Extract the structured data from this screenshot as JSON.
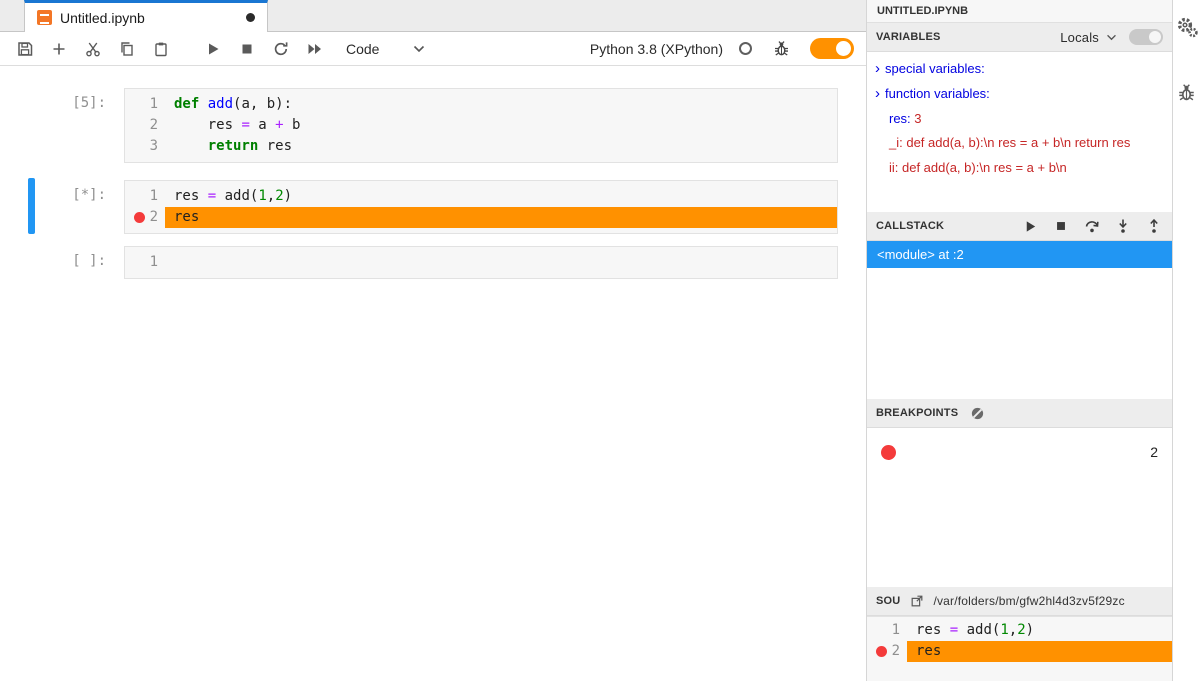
{
  "window": {
    "tab_title": "Untitled.ipynb"
  },
  "toolbar": {
    "cell_type": "Code",
    "kernel_name": "Python 3.8 (XPython)"
  },
  "notebook": {
    "cells": [
      {
        "prompt": "[5]:",
        "lines": [
          {
            "n": 1,
            "tokens": [
              [
                "def",
                "kw"
              ],
              [
                " ",
                "pl"
              ],
              [
                "add",
                "fn"
              ],
              [
                "(a, b):",
                "pl"
              ]
            ]
          },
          {
            "n": 2,
            "tokens": [
              [
                "    res ",
                "pl"
              ],
              [
                "=",
                "op"
              ],
              [
                " a ",
                "pl"
              ],
              [
                "+",
                "op"
              ],
              [
                " b",
                "pl"
              ]
            ]
          },
          {
            "n": 3,
            "tokens": [
              [
                "    ",
                "pl"
              ],
              [
                "return",
                "kw"
              ],
              [
                " res",
                "pl"
              ]
            ]
          }
        ]
      },
      {
        "prompt": "[*]:",
        "active": true,
        "lines": [
          {
            "n": 1,
            "tokens": [
              [
                "res ",
                "pl"
              ],
              [
                "=",
                "op"
              ],
              [
                " add(",
                "pl"
              ],
              [
                "1",
                "num"
              ],
              [
                ",",
                "pl"
              ],
              [
                "2",
                "num"
              ],
              [
                ")",
                "pl"
              ]
            ]
          },
          {
            "n": 2,
            "breakpoint": true,
            "highlight": true,
            "tokens": [
              [
                "res",
                "pl"
              ]
            ]
          }
        ]
      },
      {
        "prompt": "[ ]:",
        "lines": [
          {
            "n": 1,
            "tokens": []
          }
        ]
      }
    ]
  },
  "debugger": {
    "panel_title": "UNTITLED.IPYNB",
    "variables": {
      "header": "VARIABLES",
      "scope": "Locals",
      "items": [
        {
          "chevron": true,
          "segments": [
            [
              "special variables:",
              "blue"
            ]
          ]
        },
        {
          "chevron": true,
          "segments": [
            [
              "function variables:",
              "blue"
            ]
          ]
        },
        {
          "indent": true,
          "segments": [
            [
              "res: ",
              "blue"
            ],
            [
              "3",
              "red"
            ]
          ]
        },
        {
          "indent": true,
          "wrap": true,
          "segments": [
            [
              "_i: def add(a, b):\\n res = a + b\\n return res",
              "red"
            ]
          ]
        },
        {
          "indent": true,
          "segments": [
            [
              "ii: def add(a, b):\\n res = a + b\\n",
              "red"
            ]
          ]
        }
      ]
    },
    "callstack": {
      "header": "CALLSTACK",
      "frames": [
        {
          "label": "<module> at :2",
          "active": true
        }
      ]
    },
    "breakpoints": {
      "header": "BREAKPOINTS",
      "items": [
        {
          "line": "2"
        }
      ]
    },
    "source": {
      "header": "SOU",
      "path": "/var/folders/bm/gfw2hl4d3zv5f29zc",
      "lines": [
        {
          "n": 1,
          "tokens": [
            [
              "res ",
              "pl"
            ],
            [
              "=",
              "op"
            ],
            [
              " add(",
              "pl"
            ],
            [
              "1",
              "num"
            ],
            [
              ",",
              "pl"
            ],
            [
              "2",
              "num"
            ],
            [
              ")",
              "pl"
            ]
          ]
        },
        {
          "n": 2,
          "breakpoint": true,
          "highlight": true,
          "tokens": [
            [
              "res",
              "pl"
            ]
          ]
        }
      ]
    }
  },
  "colors": {
    "accent_blue": "#2196f3",
    "tab_border_blue": "#1976d2",
    "highlight_orange": "#ff9100",
    "toggle_orange": "#ff9100",
    "breakpoint_red": "#f43b3b",
    "keyword_green": "#008000",
    "number_green": "#008800",
    "operator_magenta": "#aa22ff",
    "def_blue": "#0000ff",
    "variable_blue": "#0000e0",
    "variable_red": "#c62626",
    "notebook_icon_orange": "#f37626"
  }
}
